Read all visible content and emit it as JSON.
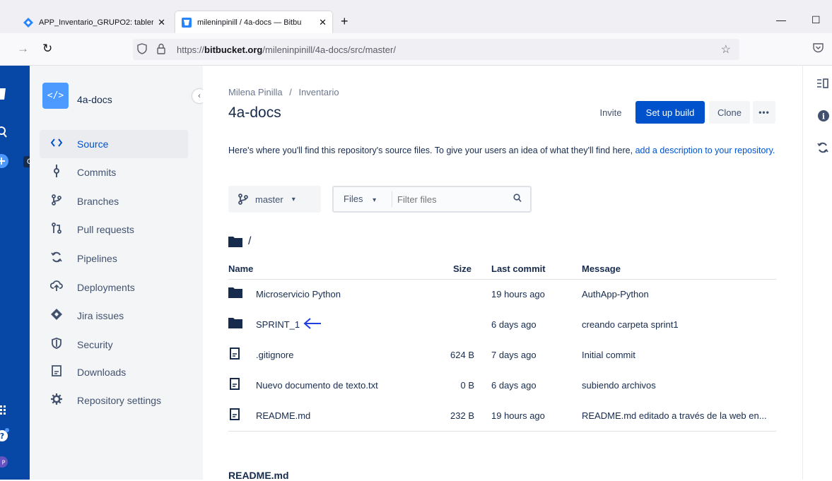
{
  "browser": {
    "tabs": [
      {
        "title": "APP_Inventario_GRUPO2: tabler",
        "active": false,
        "favicon": "jira-diamond-icon"
      },
      {
        "title": "mileninpinill / 4a-docs — Bitbu",
        "active": true,
        "favicon": "bitbucket-icon"
      }
    ],
    "close_glyph": "✕",
    "new_tab_glyph": "+",
    "minimize_glyph": "—",
    "maximize_glyph": "☐",
    "url_prefix": "https://",
    "url_domain": "bitbucket.org",
    "url_path": "/mileninpinill/4a-docs/src/master/"
  },
  "rail": {
    "tooltip": "Create"
  },
  "sidebar": {
    "repo_icon_text": "</>",
    "repo_name": "4a-docs",
    "items": [
      {
        "label": "Source",
        "icon": "code-icon",
        "glyph": "‹›",
        "selected": true
      },
      {
        "label": "Commits",
        "icon": "commit-icon",
        "glyph": "ǫ",
        "selected": false
      },
      {
        "label": "Branches",
        "icon": "branch-icon",
        "glyph": "ϟ",
        "selected": false
      },
      {
        "label": "Pull requests",
        "icon": "pull-request-icon",
        "glyph": "⇅",
        "selected": false
      },
      {
        "label": "Pipelines",
        "icon": "pipelines-icon",
        "glyph": "⟳",
        "selected": false
      },
      {
        "label": "Deployments",
        "icon": "deployments-icon",
        "glyph": "☁",
        "selected": false
      },
      {
        "label": "Jira issues",
        "icon": "jira-icon",
        "glyph": "◆",
        "selected": false
      },
      {
        "label": "Security",
        "icon": "shield-icon",
        "glyph": "⛉",
        "selected": false
      },
      {
        "label": "Downloads",
        "icon": "download-icon",
        "glyph": "▤",
        "selected": false
      },
      {
        "label": "Repository settings",
        "icon": "gear-icon",
        "glyph": "✲",
        "selected": false
      }
    ]
  },
  "main": {
    "breadcrumb_user": "Milena Pinilla",
    "breadcrumb_sep": "/",
    "breadcrumb_project": "Inventario",
    "title": "4a-docs",
    "invite_label": "Invite",
    "setup_build_label": "Set up build",
    "clone_label": "Clone",
    "more_label": "•••",
    "description_text": "Here's where you'll find this repository's source files. To give your users an idea of what they'll find here,",
    "description_link": "add a description to your repository.",
    "branch_label": "master",
    "files_label": "Files",
    "filter_placeholder": "Filter files",
    "path": "/",
    "columns": {
      "name": "Name",
      "size": "Size",
      "last_commit": "Last commit",
      "message": "Message"
    },
    "rows": [
      {
        "type": "folder",
        "name": "Microservicio Python",
        "size": "",
        "last_commit": "19 hours ago",
        "message": "AuthApp-Python"
      },
      {
        "type": "folder",
        "name": "SPRINT_1",
        "size": "",
        "last_commit": "6 days ago",
        "message": "creando carpeta sprint1",
        "annotation_arrow": true
      },
      {
        "type": "file",
        "name": ".gitignore",
        "size": "624 B",
        "last_commit": "7 days ago",
        "message": "Initial commit"
      },
      {
        "type": "file",
        "name": "Nuevo documento de texto.txt",
        "size": "0 B",
        "last_commit": "6 days ago",
        "message": "subiendo archivos"
      },
      {
        "type": "file",
        "name": "README.md",
        "size": "232 B",
        "last_commit": "19 hours ago",
        "message": "README.md editado a través de la web en..."
      }
    ],
    "readme_heading": "README.md"
  },
  "colors": {
    "brand_blue": "#0052cc",
    "rail_blue": "#0747a6",
    "sidebar_bg": "#f4f5f7",
    "annotation_arrow": "#1f3fe0"
  }
}
